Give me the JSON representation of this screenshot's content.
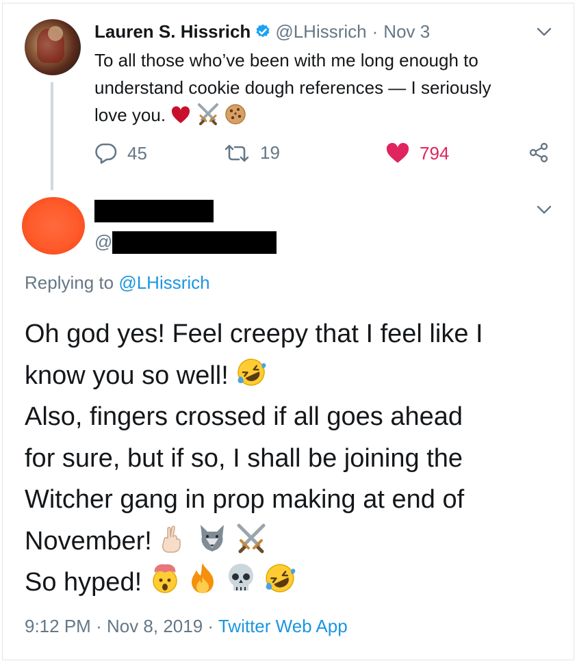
{
  "parent_tweet": {
    "author_name": "Lauren S. Hissrich",
    "author_handle": "@LHissrich",
    "separator": "·",
    "date": "Nov 3",
    "text": "To all those who’ve been with me long enough to understand cookie dough references — I seriously love you.",
    "text_lines": [
      "To all those who’ve been with me long enough to",
      "understand cookie dough references — I seriously",
      "love you."
    ],
    "text_emojis": [
      "red-heart",
      "crossed-swords",
      "cookie"
    ],
    "reply_count": "45",
    "retweet_count": "19",
    "like_count": "794",
    "icons": {
      "verified": "verified-badge-icon",
      "menu": "chevron-down-icon",
      "reply": "reply-bubble-icon",
      "retweet": "retweet-icon",
      "like": "heart-icon",
      "share": "share-icon"
    }
  },
  "reply_tweet": {
    "handle_prefix": "@",
    "replying_to_label": "Replying to",
    "replying_to_handle": "@LHissrich",
    "body_lines": [
      "Oh god yes! Feel creepy that I feel like I",
      "know you so well!",
      "Also, fingers crossed if all goes ahead",
      "for sure, but if so, I shall be joining the",
      "Witcher gang in prop making at end of",
      "November!",
      "So hyped!"
    ],
    "emojis_line2": [
      "rolling-on-floor-laughing"
    ],
    "emojis_line6": [
      "crossed-fingers",
      "wolf",
      "crossed-swords"
    ],
    "emojis_line7": [
      "exploding-head",
      "fire",
      "skull",
      "rolling-on-floor-laughing"
    ],
    "time": "9:12 PM",
    "separator": "·",
    "date": "Nov 8, 2019",
    "source": "Twitter Web App"
  },
  "colors": {
    "text": "#14171a",
    "muted": "#657786",
    "link": "#1b95e0",
    "like": "#e0245e",
    "thread_line": "#cfd9de",
    "reply_avatar": "#ff5a2a"
  }
}
